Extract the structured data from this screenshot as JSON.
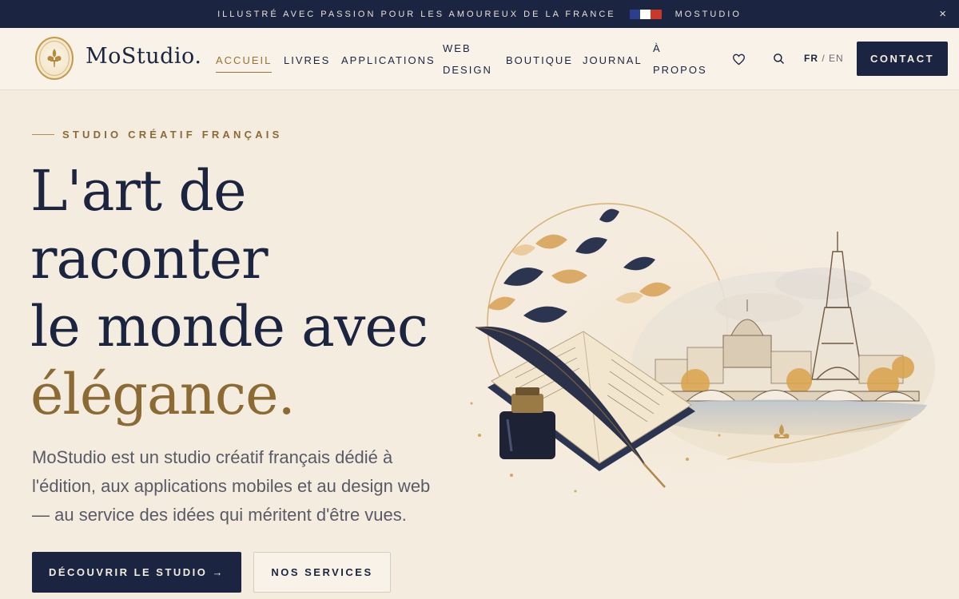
{
  "announcement": {
    "text": "ILLUSTRÉ AVEC PASSION POUR LES AMOUREUX DE LA FRANCE",
    "brand": "MOSTUDIO",
    "close_label": "×",
    "flag_colors": [
      "#2b3f8f",
      "#ffffff",
      "#c8392c"
    ]
  },
  "header": {
    "logo_text": "MoStudio.",
    "nav": {
      "accueil": "ACCUEIL",
      "livres": "LIVRES",
      "applications": "APPLICATIONS",
      "web_design_line1": "WEB",
      "web_design_line2": "DESIGN",
      "boutique": "BOUTIQUE",
      "journal": "JOURNAL",
      "apropos_line1": "À",
      "apropos_line2": "PROPOS"
    },
    "icons": {
      "favorites": "heart-icon",
      "search": "search-icon"
    },
    "lang": {
      "current": "FR",
      "separator": "/",
      "other": "EN"
    },
    "contact_label": "CONTACT"
  },
  "hero": {
    "eyebrow": "STUDIO CRÉATIF FRANÇAIS",
    "title_line1": "L'art de",
    "title_line2": "raconter",
    "title_line3": "le monde avec",
    "title_accent": "élégance.",
    "description": "MoStudio est un studio créatif français dédié à l'édition, aux applications mobiles et au design web — au service des idées qui méritent d'être vues.",
    "primary_cta": "DÉCOUVRIR LE STUDIO →",
    "secondary_cta": "NOS SERVICES"
  },
  "colors": {
    "navy": "#1b2542",
    "gold": "#8b6a33",
    "cream": "#f5ece0"
  }
}
